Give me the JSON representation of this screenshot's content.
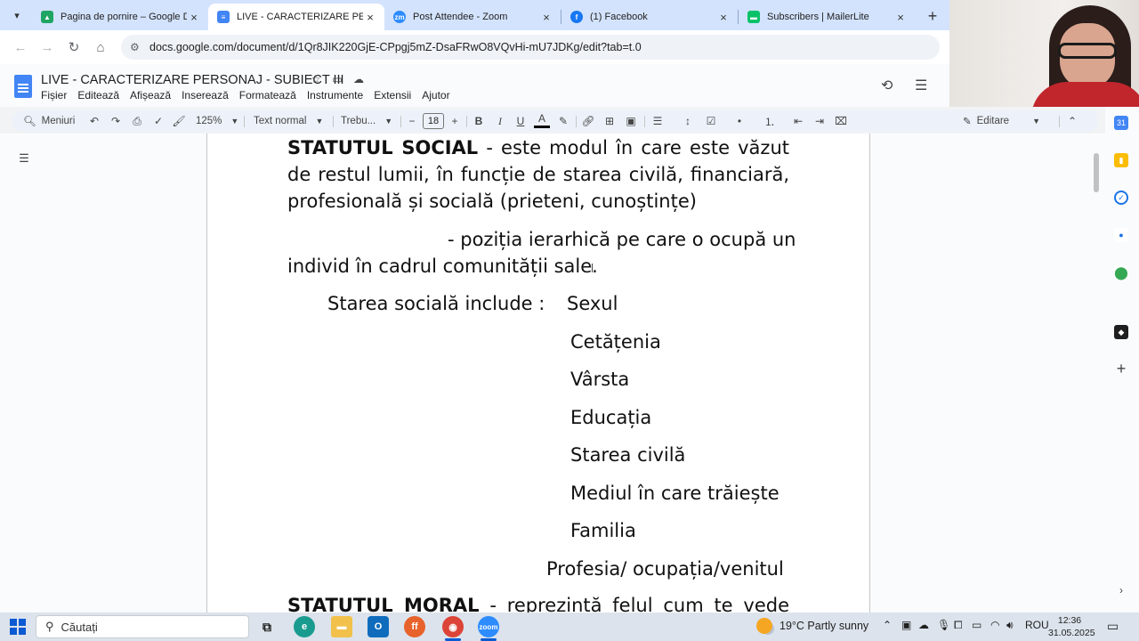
{
  "browser": {
    "tabs": [
      {
        "title": "Pagina de pornire – Google Dri",
        "icon": "google-drive-icon",
        "color": "#1fa463"
      },
      {
        "title": "LIVE - CARACTERIZARE PERSON",
        "icon": "google-docs-icon",
        "color": "#4285f4"
      },
      {
        "title": "Post Attendee - Zoom",
        "icon": "zoom-icon",
        "color": "#2d8cff"
      },
      {
        "title": "(1) Facebook",
        "icon": "facebook-icon",
        "color": "#1877f2"
      },
      {
        "title": "Subscribers | MailerLite",
        "icon": "mailerlite-icon",
        "color": "#09c269"
      }
    ],
    "active_tab_index": 1,
    "url": "docs.google.com/document/d/1Qr8JIK220GjE-CPpgj5mZ-DsaFRwO8VQvHi-mU7JDKg/edit?tab=t.0"
  },
  "docs": {
    "title": "LIVE - CARACTERIZARE PERSONAJ - SUBIECT III",
    "menu": [
      "Fișier",
      "Editează",
      "Afișează",
      "Inserează",
      "Formatează",
      "Instrumente",
      "Extensii",
      "Ajutor"
    ],
    "toolbar": {
      "search_label": "Meniuri",
      "zoom": "125%",
      "style": "Text normal",
      "font": "Trebu...",
      "font_size": "18",
      "mode": "Editare"
    }
  },
  "document": {
    "para1_heading": "STATUTUL SOCIAL",
    "para1_line1_rest": " -  este modul în care este văzut",
    "para1_line2": "de restul lumii, în funcție de starea civilă, financiară,",
    "para1_line3": "profesională și socială (prieteni, cunoștințe)",
    "para2_line1": "- poziția ierarhică pe care o ocupă un",
    "para2_line2": "individ în cadrul comunității sale.",
    "list_intro": "Starea socială include :",
    "list_items": [
      "Sexul",
      "Cetățenia",
      "Vârsta",
      "Educația",
      "Starea civilă",
      "Mediul în care trăiește",
      "Familia"
    ],
    "list_last": "Profesia/ ocupația/venitul",
    "para3_heading": "STATUTUL  MORAL",
    "para3_rest": " -  reprezintă  felul  cum  te  vede"
  },
  "taskbar": {
    "search_placeholder": "Căutați",
    "weather": "19°C  Partly sunny",
    "language": "ROU",
    "time": "12:36",
    "date": "31.05.2025"
  }
}
